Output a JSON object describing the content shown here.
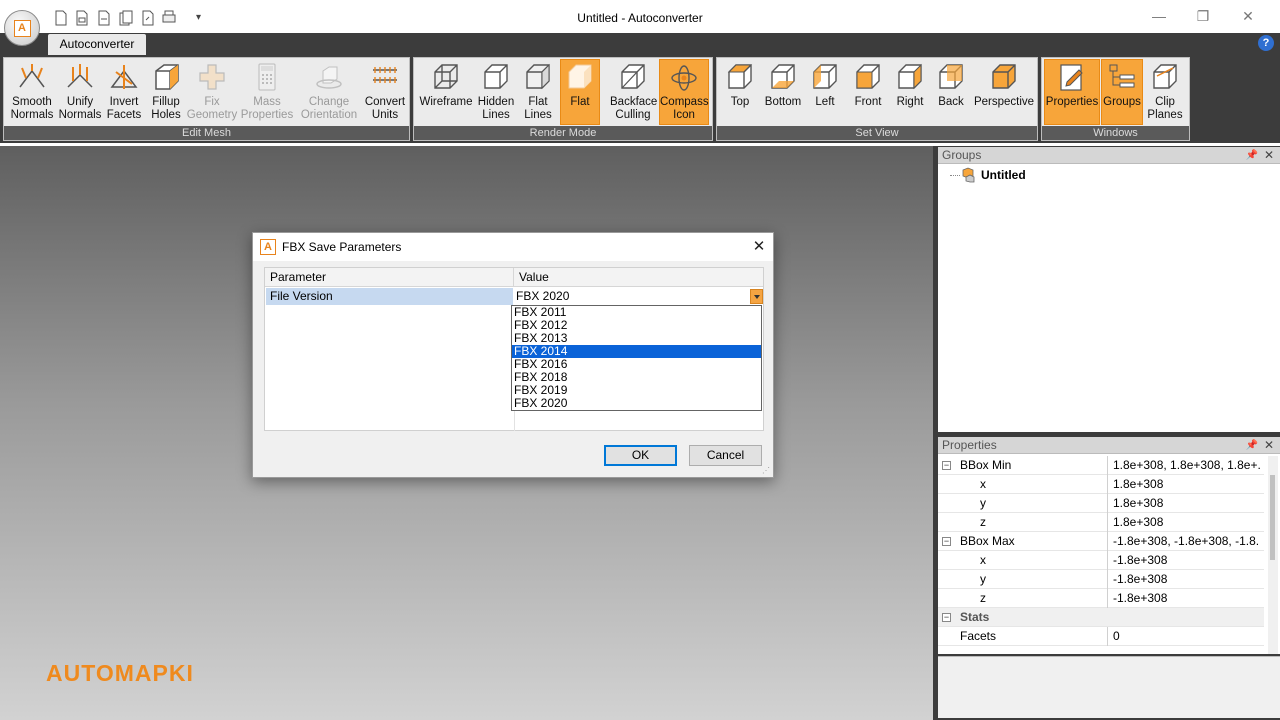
{
  "app": {
    "title": "Untitled - Autoconverter",
    "logo_letter": "A",
    "tab": "Autoconverter"
  },
  "window_controls": {
    "minimize": "—",
    "restore": "❐",
    "close": "✕"
  },
  "quick_access": [
    "new-icon",
    "open-icon",
    "save-icon",
    "copy-icon",
    "export-icon",
    "print-icon"
  ],
  "ribbon": {
    "edit_mesh": {
      "label": "Edit Mesh",
      "buttons": [
        {
          "l1": "Smooth",
          "l2": "Normals",
          "icon": "smooth-normals-icon"
        },
        {
          "l1": "Unify",
          "l2": "Normals",
          "icon": "unify-normals-icon"
        },
        {
          "l1": "Invert",
          "l2": "Facets",
          "icon": "invert-facets-icon"
        },
        {
          "l1": "Fillup",
          "l2": "Holes",
          "icon": "fillup-holes-icon"
        },
        {
          "l1": "Fix",
          "l2": "Geometry",
          "icon": "fix-geometry-icon"
        },
        {
          "l1": "Mass",
          "l2": "Properties",
          "icon": "mass-properties-icon"
        },
        {
          "l1": "Change",
          "l2": "Orientation",
          "icon": "change-orientation-icon"
        },
        {
          "l1": "Convert",
          "l2": "Units",
          "icon": "convert-units-icon"
        }
      ]
    },
    "render_mode": {
      "label": "Render Mode",
      "buttons": [
        {
          "l1": "Wireframe",
          "l2": ""
        },
        {
          "l1": "Hidden",
          "l2": "Lines"
        },
        {
          "l1": "Flat",
          "l2": "Lines"
        },
        {
          "l1": "Flat",
          "l2": ""
        },
        {
          "l1": "Backface",
          "l2": "Culling"
        },
        {
          "l1": "Compass",
          "l2": "Icon"
        }
      ]
    },
    "set_view": {
      "label": "Set View",
      "buttons": [
        {
          "l1": "Top"
        },
        {
          "l1": "Bottom"
        },
        {
          "l1": "Left"
        },
        {
          "l1": "Front"
        },
        {
          "l1": "Right"
        },
        {
          "l1": "Back"
        },
        {
          "l1": "Perspective"
        }
      ]
    },
    "windows": {
      "label": "Windows",
      "buttons": [
        {
          "l1": "Properties",
          "l2": ""
        },
        {
          "l1": "Groups",
          "l2": ""
        },
        {
          "l1": "Clip",
          "l2": "Planes"
        }
      ]
    }
  },
  "groups_panel": {
    "title": "Groups",
    "root": "Untitled"
  },
  "properties_panel": {
    "title": "Properties",
    "rows": [
      {
        "key": "BBox Min",
        "value": "1.8e+308, 1.8e+308, 1.8e+..."
      },
      {
        "key": "x",
        "value": "1.8e+308"
      },
      {
        "key": "y",
        "value": "1.8e+308"
      },
      {
        "key": "z",
        "value": "1.8e+308"
      },
      {
        "key": "BBox Max",
        "value": "-1.8e+308, -1.8e+308, -1.8..."
      },
      {
        "key": "x",
        "value": "-1.8e+308"
      },
      {
        "key": "y",
        "value": "-1.8e+308"
      },
      {
        "key": "z",
        "value": "-1.8e+308"
      },
      {
        "key": "Stats",
        "value": ""
      },
      {
        "key": "Facets",
        "value": "0"
      }
    ]
  },
  "brand": "AUTOMAPKI",
  "dialog": {
    "title": "FBX Save Parameters",
    "col_parameter": "Parameter",
    "col_value": "Value",
    "row_label": "File Version",
    "row_value": "FBX 2020",
    "options": [
      "FBX 2011",
      "FBX 2012",
      "FBX 2013",
      "FBX 2014",
      "FBX 2016",
      "FBX 2018",
      "FBX 2019",
      "FBX 2020"
    ],
    "highlighted_option": "FBX 2014",
    "ok": "OK",
    "cancel": "Cancel"
  },
  "colors": {
    "accent_orange": "#f7a53a",
    "ribbon_dark": "#3c3c3c",
    "selection_blue": "#0a63d8",
    "brand_orange": "#ef8a1e"
  }
}
